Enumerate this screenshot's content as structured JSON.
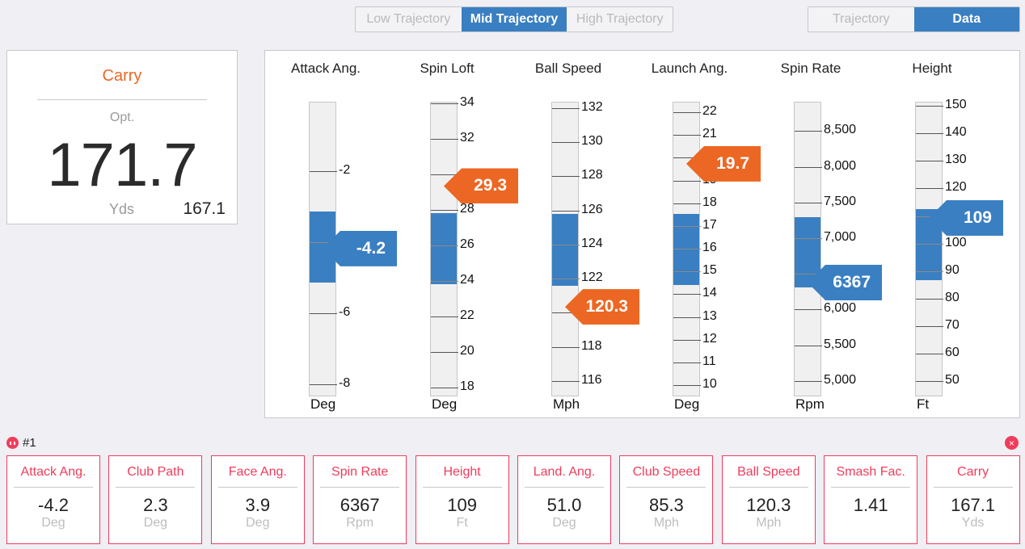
{
  "trajectory_selector": {
    "options": [
      "Low Trajectory",
      "Mid Trajectory",
      "High Trajectory"
    ],
    "selected": "Mid Trajectory"
  },
  "view_selector": {
    "options": [
      "Trajectory",
      "Data"
    ],
    "selected": "Data"
  },
  "carry_card": {
    "title": "Carry",
    "optimal_label": "Opt.",
    "optimal_value": "171.7",
    "unit": "Yds",
    "actual_value": "167.1"
  },
  "colors": {
    "accent_blue": "#3a7fc1",
    "accent_orange": "#ec6723",
    "shot_red": "#f03c5c"
  },
  "gauges": [
    {
      "title": "Attack Ang.",
      "unit": "Deg",
      "range": [
        -8.36,
        -0.07
      ],
      "ticks": [
        -2,
        -4,
        -6,
        -8
      ],
      "tick_labels": [
        {
          "v": -2,
          "t": "-2"
        },
        {
          "v": -6,
          "t": "-6"
        },
        {
          "v": -8,
          "t": "-8"
        }
      ],
      "optimal_band": [
        -5.14,
        -3.14
      ],
      "value": -4.2,
      "value_label": "-4.2",
      "marker_color": "blue"
    },
    {
      "title": "Spin Loft",
      "unit": "Deg",
      "range": [
        17.45,
        34.05
      ],
      "ticks": [
        34,
        32,
        30,
        28,
        26,
        24,
        22,
        20,
        18
      ],
      "tick_labels": [
        {
          "v": 34,
          "t": "34"
        },
        {
          "v": 32,
          "t": "32"
        },
        {
          "v": 28,
          "t": "28"
        },
        {
          "v": 26,
          "t": "26"
        },
        {
          "v": 24,
          "t": "24"
        },
        {
          "v": 22,
          "t": "22"
        },
        {
          "v": 20,
          "t": "20"
        },
        {
          "v": 18,
          "t": "18"
        }
      ],
      "optimal_band": [
        23.8,
        27.8
      ],
      "value": 29.3,
      "value_label": "29.3",
      "marker_color": "orange"
    },
    {
      "title": "Ball Speed",
      "unit": "Mph",
      "range": [
        115.05,
        132.33
      ],
      "ticks": [
        132,
        130,
        128,
        126,
        124,
        122,
        120,
        118,
        116
      ],
      "tick_labels": [
        {
          "v": 132,
          "t": "132"
        },
        {
          "v": 130,
          "t": "130"
        },
        {
          "v": 128,
          "t": "128"
        },
        {
          "v": 126,
          "t": "126"
        },
        {
          "v": 124,
          "t": "124"
        },
        {
          "v": 122,
          "t": "122"
        },
        {
          "v": 118,
          "t": "118"
        },
        {
          "v": 116,
          "t": "116"
        }
      ],
      "optimal_band": [
        121.6,
        125.8
      ],
      "value": 120.3,
      "value_label": "120.3",
      "marker_color": "orange"
    },
    {
      "title": "Launch Ang.",
      "unit": "Deg",
      "range": [
        9.47,
        22.43
      ],
      "ticks": [
        22,
        21,
        20,
        19,
        18,
        17,
        16,
        15,
        14,
        13,
        12,
        11,
        10
      ],
      "tick_labels": [
        {
          "v": 22,
          "t": "22"
        },
        {
          "v": 21,
          "t": "21"
        },
        {
          "v": 19,
          "t": "19"
        },
        {
          "v": 18,
          "t": "18"
        },
        {
          "v": 17,
          "t": "17"
        },
        {
          "v": 16,
          "t": "16"
        },
        {
          "v": 15,
          "t": "15"
        },
        {
          "v": 14,
          "t": "14"
        },
        {
          "v": 13,
          "t": "13"
        },
        {
          "v": 12,
          "t": "12"
        },
        {
          "v": 11,
          "t": "11"
        },
        {
          "v": 10,
          "t": "10"
        }
      ],
      "optimal_band": [
        14.41,
        17.53
      ],
      "value": 19.7,
      "value_label": "19.7",
      "marker_color": "orange"
    },
    {
      "title": "Spin Rate",
      "unit": "Rpm",
      "range": [
        4773,
        8900
      ],
      "ticks": [
        8500,
        8000,
        7500,
        7000,
        6500,
        6000,
        5500,
        5000
      ],
      "tick_labels": [
        {
          "v": 8500,
          "t": "8,500"
        },
        {
          "v": 8000,
          "t": "8,000"
        },
        {
          "v": 7500,
          "t": "7,500"
        },
        {
          "v": 7000,
          "t": "7,000"
        },
        {
          "v": 6000,
          "t": "6,000"
        },
        {
          "v": 5500,
          "t": "5,500"
        },
        {
          "v": 5000,
          "t": "5,000"
        }
      ],
      "optimal_band": [
        6306,
        7299
      ],
      "value": 6367,
      "value_label": "6367",
      "marker_color": "blue"
    },
    {
      "title": "Height",
      "unit": "Ft",
      "range": [
        44.2,
        151.2
      ],
      "ticks": [
        150,
        140,
        130,
        120,
        110,
        100,
        90,
        80,
        70,
        60,
        50
      ],
      "tick_labels": [
        {
          "v": 150,
          "t": "150"
        },
        {
          "v": 140,
          "t": "140"
        },
        {
          "v": 130,
          "t": "130"
        },
        {
          "v": 120,
          "t": "120"
        },
        {
          "v": 100,
          "t": "100"
        },
        {
          "v": 90,
          "t": "90"
        },
        {
          "v": 80,
          "t": "80"
        },
        {
          "v": 70,
          "t": "70"
        },
        {
          "v": 60,
          "t": "60"
        },
        {
          "v": 50,
          "t": "50"
        }
      ],
      "optimal_band": [
        86.8,
        112.6
      ],
      "value": 109,
      "value_label": "109",
      "marker_color": "blue"
    }
  ],
  "shot": {
    "label": "#1",
    "close_label": "×",
    "stats": [
      {
        "label": "Attack Ang.",
        "value": "-4.2",
        "unit": "Deg"
      },
      {
        "label": "Club Path",
        "value": "2.3",
        "unit": "Deg"
      },
      {
        "label": "Face Ang.",
        "value": "3.9",
        "unit": "Deg"
      },
      {
        "label": "Spin Rate",
        "value": "6367",
        "unit": "Rpm"
      },
      {
        "label": "Height",
        "value": "109",
        "unit": "Ft"
      },
      {
        "label": "Land. Ang.",
        "value": "51.0",
        "unit": "Deg"
      },
      {
        "label": "Club Speed",
        "value": "85.3",
        "unit": "Mph"
      },
      {
        "label": "Ball Speed",
        "value": "120.3",
        "unit": "Mph"
      },
      {
        "label": "Smash Fac.",
        "value": "1.41",
        "unit": ""
      },
      {
        "label": "Carry",
        "value": "167.1",
        "unit": "Yds"
      }
    ]
  }
}
